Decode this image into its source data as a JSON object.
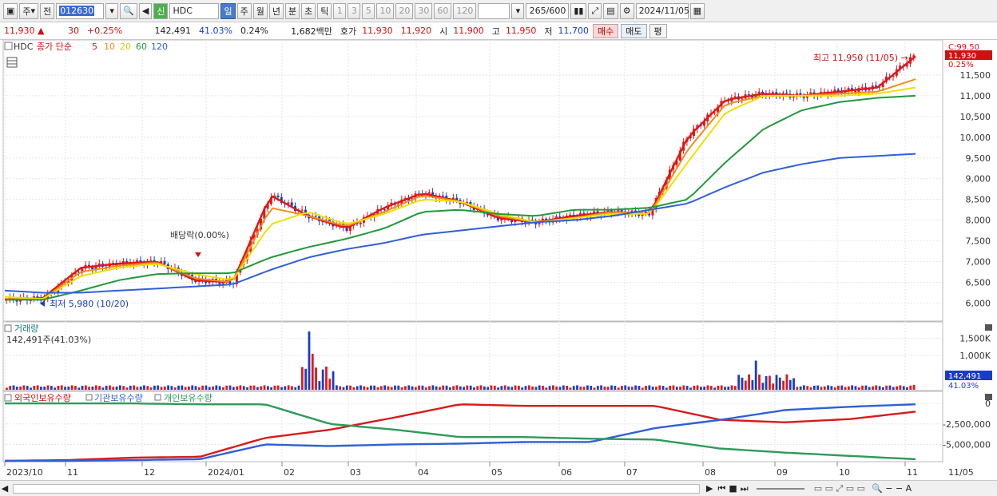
{
  "toolbar": {
    "period_unit": "주",
    "prev": "전",
    "code": "012630",
    "stock_name": "HDC",
    "credit": "신",
    "periods": [
      "일",
      "주",
      "월",
      "년",
      "분",
      "초",
      "틱"
    ],
    "intervals": [
      "1",
      "3",
      "5",
      "10",
      "20",
      "30",
      "60",
      "120"
    ],
    "count": "265",
    "max_count": "/600",
    "date": "2024/11/05"
  },
  "quote": {
    "price": "11,930",
    "change": "30",
    "change_pct": "+0.25%",
    "volume": "142,491",
    "vol_ratio": "41.03%",
    "turnover_pct": "0.24%",
    "amount": "1,682백만",
    "ask_label": "호가",
    "ask": "11,930",
    "bid": "11,920",
    "open_label": "시",
    "open": "11,900",
    "high_label": "고",
    "high": "11,950",
    "low_label": "저",
    "low": "11,700",
    "buy_btn": "매수",
    "sell_btn": "매도",
    "avg_btn": "평"
  },
  "legend": {
    "name": "HDC",
    "title": "종가 단순",
    "ma": [
      "5",
      "10",
      "20",
      "60",
      "120"
    ]
  },
  "annotations": {
    "high": "최고 11,950 (11/05) →",
    "low": "최저 5,980 (10/20)",
    "dividend": "배당락(0.00%)",
    "scale_top": "C:99.50",
    "current_price": "11,930",
    "current_pct": "0.25%"
  },
  "volume_panel": {
    "title": "거래량",
    "info": "142,491주(41.03%)",
    "current": "142,491",
    "current_pct": "41.03%"
  },
  "holdings_panel": {
    "labels": [
      "외국인보유수량",
      "기관보유수량",
      "개인보유수량"
    ]
  },
  "colors": {
    "up": "#e01818",
    "down": "#1a3cc8",
    "ma5": "#e01818",
    "ma10": "#f08c1a",
    "ma20": "#f0e000",
    "ma60": "#22993a",
    "ma120": "#2f5fd8",
    "foreign": "#d81a1a",
    "institution": "#2f5fd8",
    "individual": "#2e9a5a"
  },
  "chart_data": [
    {
      "type": "line",
      "title": "HDC 종가 단순",
      "x": [
        "2023/10",
        "11",
        "12",
        "2024/01",
        "02",
        "03",
        "04",
        "05",
        "06",
        "07",
        "08",
        "09",
        "10",
        "11"
      ],
      "yticks": [
        6000,
        6500,
        7000,
        7500,
        8000,
        8500,
        9000,
        9500,
        10000,
        10500,
        11000,
        11500
      ],
      "ylim": [
        5700,
        12000
      ],
      "series": [
        {
          "name": "5",
          "values": [
            6080,
            6120,
            6850,
            6950,
            7000,
            6550,
            6500,
            8600,
            8100,
            7800,
            8300,
            8650,
            8450,
            8050,
            7950,
            8100,
            8200,
            8150,
            10000,
            10900,
            11050,
            11000,
            11100,
            11200,
            11950
          ]
        },
        {
          "name": "10",
          "values": [
            6100,
            6100,
            6750,
            6900,
            6980,
            6600,
            6500,
            8300,
            8100,
            7850,
            8200,
            8600,
            8450,
            8100,
            7950,
            8050,
            8200,
            8150,
            9700,
            10800,
            11000,
            11000,
            11050,
            11100,
            11400
          ]
        },
        {
          "name": "20",
          "values": [
            6150,
            6100,
            6650,
            6850,
            6950,
            6700,
            6550,
            7900,
            8200,
            7900,
            8150,
            8500,
            8450,
            8150,
            7950,
            8050,
            8150,
            8150,
            9400,
            10600,
            11000,
            11000,
            11000,
            11050,
            11200
          ]
        },
        {
          "name": "60",
          "values": [
            6080,
            6080,
            6300,
            6550,
            6700,
            6720,
            6720,
            7100,
            7350,
            7550,
            7800,
            8200,
            8250,
            8150,
            8100,
            8250,
            8250,
            8300,
            8500,
            9400,
            10200,
            10650,
            10850,
            10950,
            11000
          ]
        },
        {
          "name": "120",
          "values": [
            6300,
            6250,
            6250,
            6300,
            6350,
            6400,
            6450,
            6800,
            7100,
            7300,
            7450,
            7650,
            7750,
            7850,
            7950,
            8000,
            8100,
            8250,
            8400,
            8800,
            9150,
            9350,
            9500,
            9550,
            9600
          ]
        }
      ],
      "high": 11950,
      "low": 5980
    },
    {
      "type": "bar",
      "title": "거래량",
      "yticks": [
        "1,000K",
        "1,500K"
      ],
      "ylim": [
        0,
        1700000
      ],
      "current": 142491
    },
    {
      "type": "line",
      "title": "보유수량",
      "yticks": [
        "0",
        "-2,500,000",
        "-5,000,000"
      ],
      "ylim": [
        -7000000,
        500000
      ],
      "series": [
        {
          "name": "외국인보유수량",
          "values": [
            -7000000,
            -6900000,
            -6600000,
            -6500000,
            -4200000,
            -3200000,
            -1700000,
            -100000,
            -300000,
            -300000,
            -300000,
            -2000000,
            -2300000,
            -1900000,
            -1000000
          ]
        },
        {
          "name": "기관보유수량",
          "values": [
            -7000000,
            -7000000,
            -6900000,
            -6800000,
            -5000000,
            -5200000,
            -5000000,
            -4900000,
            -4700000,
            -4700000,
            -3000000,
            -2000000,
            -800000,
            -400000,
            -100000
          ]
        },
        {
          "name": "개인보유수량",
          "values": [
            0,
            0,
            0,
            -100000,
            -100000,
            -2500000,
            -3200000,
            -4100000,
            -4100000,
            -4300000,
            -4400000,
            -5500000,
            -6000000,
            -6400000,
            -6800000
          ]
        }
      ]
    }
  ]
}
